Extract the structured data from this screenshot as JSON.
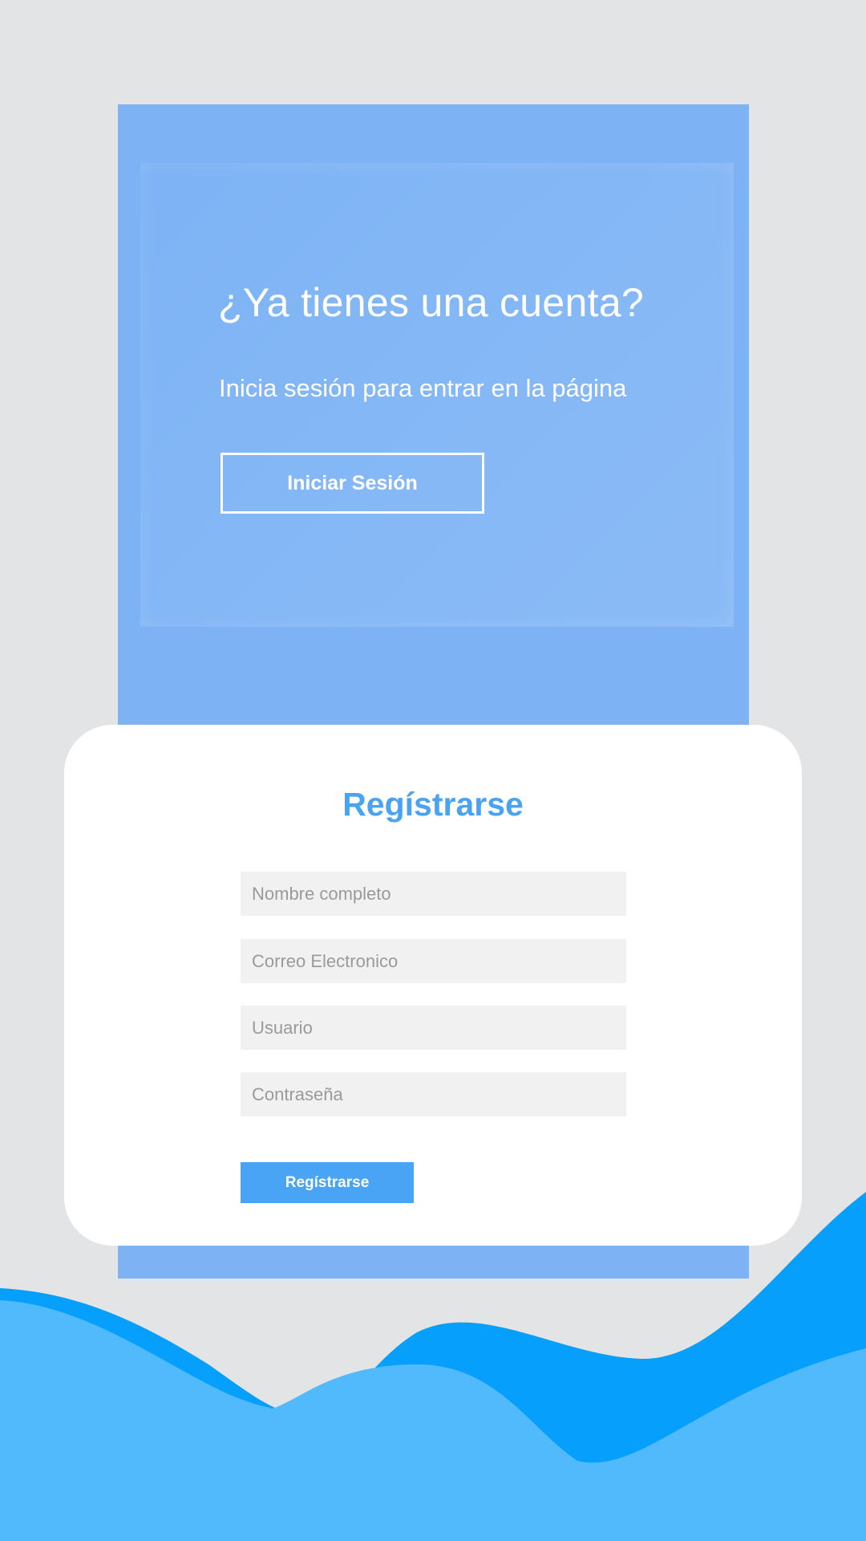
{
  "colors": {
    "background": "#e3e4e6",
    "panel_blue": "#7db3f5",
    "accent_blue": "#4aa3f1",
    "button_blue": "#49a4f5",
    "wave_dark": "#069ffb",
    "wave_light": "#50bafd",
    "field_background": "#f1f1f1"
  },
  "login": {
    "title": "¿Ya tienes una cuenta?",
    "subtitle": "Inicia sesión para entrar en la página",
    "button_label": "Iniciar Sesión"
  },
  "register": {
    "title": "Regístrarse",
    "fields": [
      {
        "placeholder": "Nombre completo",
        "value": ""
      },
      {
        "placeholder": "Correo Electronico",
        "value": ""
      },
      {
        "placeholder": "Usuario",
        "value": ""
      },
      {
        "placeholder": "Contraseña",
        "value": ""
      }
    ],
    "button_label": "Regístrarse"
  }
}
